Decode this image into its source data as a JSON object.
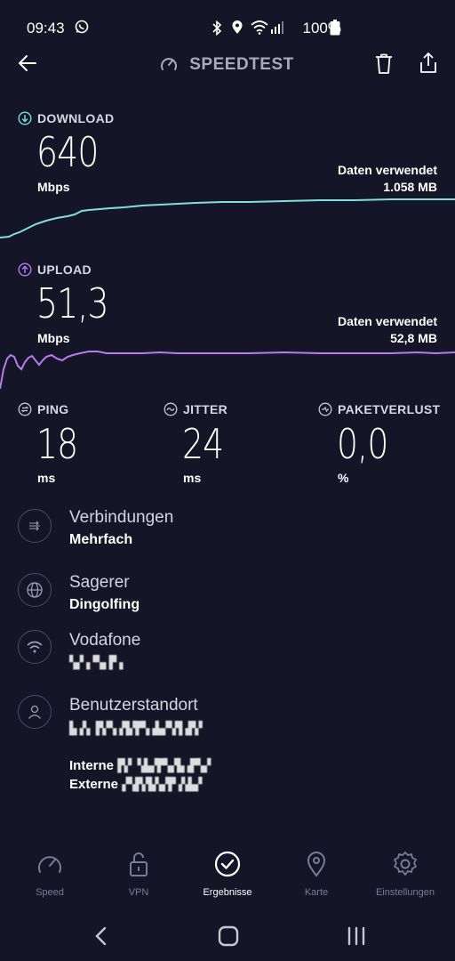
{
  "status_bar": {
    "time": "09:43",
    "battery": "100%"
  },
  "header": {
    "title": "SPEEDTEST"
  },
  "download": {
    "label": "DOWNLOAD",
    "value": "640",
    "unit": "Mbps",
    "data_used_label": "Daten verwendet",
    "data_used_value": "1.058 MB",
    "color": "#7ee0d6"
  },
  "upload": {
    "label": "UPLOAD",
    "value": "51,3",
    "unit": "Mbps",
    "data_used_label": "Daten verwendet",
    "data_used_value": "52,8 MB",
    "color": "#b57cf0"
  },
  "metrics": [
    {
      "label": "PING",
      "value": "18",
      "unit": "ms"
    },
    {
      "label": "JITTER",
      "value": "24",
      "unit": "ms"
    },
    {
      "label": "PAKETVERLUST",
      "value": "0,0",
      "unit": "%"
    }
  ],
  "info": {
    "connections": {
      "title": "Verbindungen",
      "value": "Mehrfach"
    },
    "server": {
      "title": "Sagerer",
      "value": "Dingolfing"
    },
    "provider": {
      "title": "Vodafone",
      "value": "▚▞▗▝▚▖▛▗"
    },
    "location": {
      "title": "Benutzerstandort",
      "value": "▙▗▚ ▛▞▚▗▜▞▛▚▗▙▞▚▜▗▛▞"
    },
    "internal_label": "Interne",
    "internal_value": "▛▞ ▚▙▞▛▚▞▙▗▛▚▞",
    "external_label": "Externe",
    "external_value": "▞▚▛▞▙▚▞▛▗▚▙▞"
  },
  "bottom_nav": [
    {
      "label": "Speed",
      "icon": "speedometer-icon"
    },
    {
      "label": "VPN",
      "icon": "lock-icon"
    },
    {
      "label": "Ergebnisse",
      "icon": "check-circle-icon",
      "active": true
    },
    {
      "label": "Karte",
      "icon": "map-pin-icon"
    },
    {
      "label": "Einstellungen",
      "icon": "gear-icon"
    }
  ]
}
